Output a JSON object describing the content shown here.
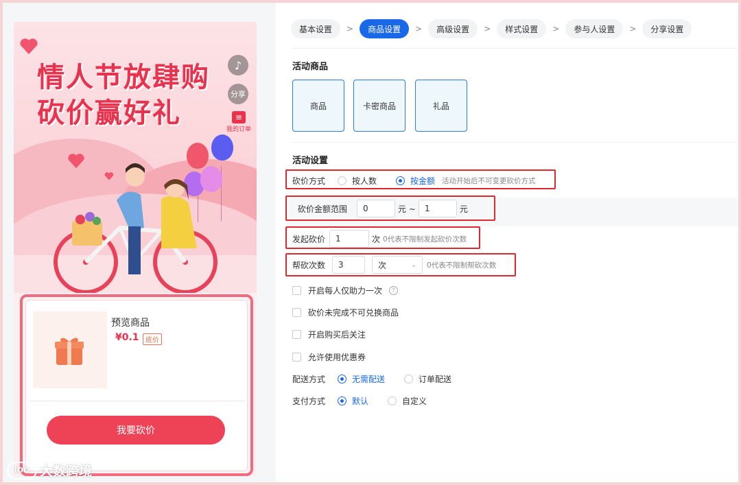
{
  "preview": {
    "title_line1": "情人节放肆购",
    "title_line2": "砍价赢好礼",
    "music_icon_glyph": "♪",
    "share_label": "分享",
    "order_label": "我的订单",
    "product": {
      "name": "预览商品",
      "price": "¥0.1",
      "tag": "底价"
    },
    "cut_button": "我要砍价",
    "watermark": "大数跨境",
    "watermark_logo": "IOO",
    "colors": {
      "brand_red": "#e8334f",
      "button_red": "#ee4257"
    }
  },
  "steps": [
    {
      "label": "基本设置"
    },
    {
      "label": "商品设置"
    },
    {
      "label": "高级设置"
    },
    {
      "label": "样式设置"
    },
    {
      "label": "参与人设置"
    },
    {
      "label": "分享设置"
    }
  ],
  "step_separator": ">",
  "active_step": "商品设置",
  "goods_section": {
    "title": "活动商品",
    "options": [
      "商品",
      "卡密商品",
      "礼品"
    ]
  },
  "activity_section": {
    "title": "活动设置",
    "cut_method": {
      "label": "砍价方式",
      "options": [
        "按人数",
        "按金额"
      ],
      "selected": "按金额",
      "hint": "活动开始后不可变更砍价方式"
    },
    "amount_range": {
      "label": "砍价金额范围",
      "min": "0",
      "unit_sep": "元 ~",
      "max": "1",
      "unit": "元"
    },
    "initiate": {
      "label": "发起砍价",
      "value": "1",
      "unit": "次",
      "hint": "0代表不限制发起砍价次数"
    },
    "help": {
      "label": "帮砍次数",
      "value": "3",
      "unit_select": "次",
      "hint": "0代表不限制帮砍次数"
    },
    "checkboxes": [
      "开启每人仅助力一次",
      "砍价未完成不可兑换商品",
      "开启购买后关注",
      "允许使用优惠券"
    ],
    "help_icon": "?",
    "delivery": {
      "label": "配送方式",
      "options": [
        "无需配送",
        "订单配送"
      ],
      "selected": "无需配送"
    },
    "payment": {
      "label": "支付方式",
      "options": [
        "默认",
        "自定义"
      ],
      "selected": "默认"
    }
  },
  "colors": {
    "accent": "#1868e8",
    "highlight_box": "#e0262e"
  }
}
